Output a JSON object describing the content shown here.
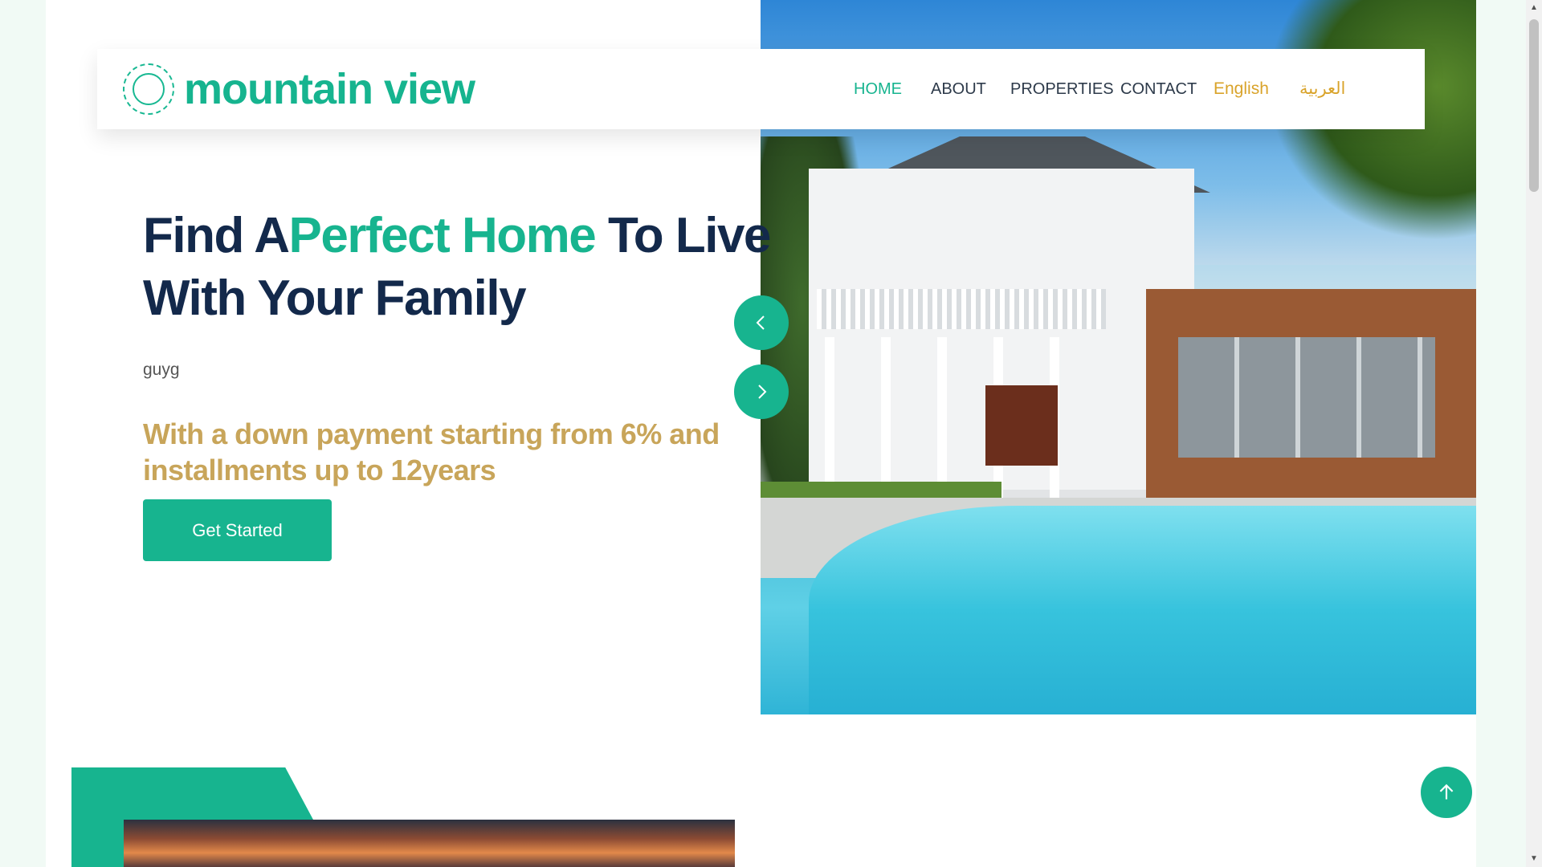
{
  "brand": {
    "name": "mountain view",
    "logo_icon": "handshake-house-icon",
    "accent": "#17b48f",
    "gold": "#c8a55a"
  },
  "nav": {
    "items": [
      {
        "label": "HOME",
        "active": true
      },
      {
        "label": "ABOUT",
        "active": false
      },
      {
        "label": "PROPERTIES",
        "active": false
      },
      {
        "label": "CONTACT",
        "active": false
      }
    ],
    "languages": [
      "English",
      "العربية"
    ]
  },
  "hero": {
    "title_part1": "Find A",
    "title_accent": "Perfect Home",
    "title_part2": " To Live With Your Family",
    "subtitle": "guyg",
    "promo": "With a down payment starting from 6% and installments up to 12years",
    "cta_label": "Get Started",
    "image": "house-with-pool-photo"
  },
  "slider": {
    "prev_icon": "chevron-left-icon",
    "next_icon": "chevron-right-icon"
  },
  "scroll_top": {
    "icon": "arrow-up-icon"
  }
}
